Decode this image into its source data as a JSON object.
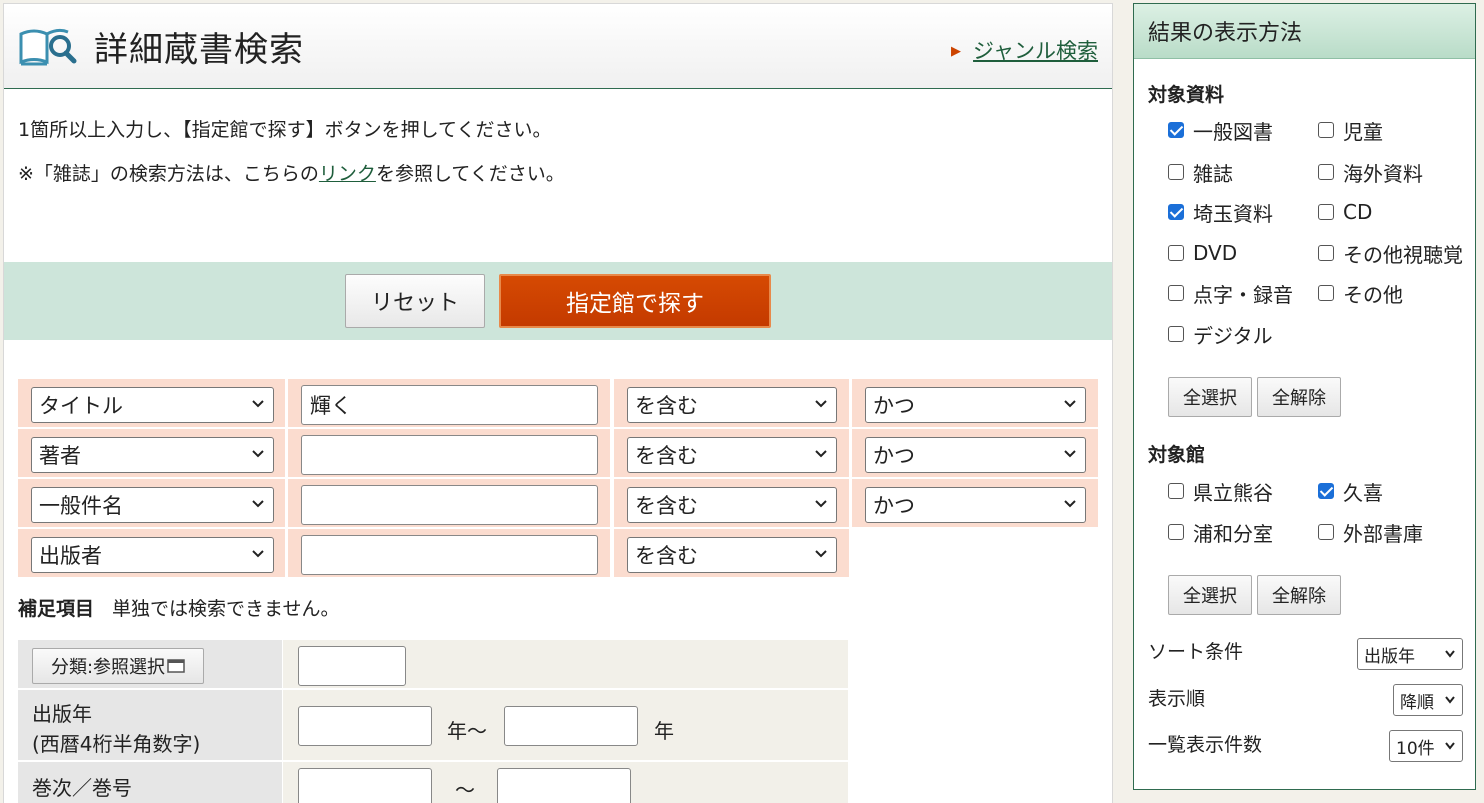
{
  "header": {
    "title": "詳細蔵書検索",
    "genre_link": "ジャンル検索"
  },
  "instructions": {
    "line1": "1箇所以上入力し、【指定館で探す】ボタンを押してください。",
    "line2_pre": "※「雑誌」の検索方法は、こちらの",
    "line2_link": "リンク",
    "line2_post": "を参照してください。"
  },
  "buttons": {
    "reset": "リセット",
    "search": "指定館で探す"
  },
  "search_rows": [
    {
      "field": "タイトル",
      "value": "輝く",
      "match": "を含む",
      "op": "かつ"
    },
    {
      "field": "著者",
      "value": "",
      "match": "を含む",
      "op": "かつ"
    },
    {
      "field": "一般件名",
      "value": "",
      "match": "を含む",
      "op": "かつ"
    },
    {
      "field": "出版者",
      "value": "",
      "match": "を含む"
    }
  ],
  "supplement": {
    "heading": "補足項目",
    "note": "単独では検索できません。",
    "classify_button": "分類:参照選択",
    "pub_year_label1": "出版年",
    "pub_year_label2": "(西暦4桁半角数字)",
    "year_sep": "年～",
    "year_suffix": "年",
    "volume_label": "巻次／巻号",
    "volume_sep": "～"
  },
  "side": {
    "title": "結果の表示方法",
    "materials_heading": "対象資料",
    "materials": [
      {
        "label": "一般図書",
        "checked": true
      },
      {
        "label": "児童",
        "checked": false
      },
      {
        "label": "雑誌",
        "checked": false
      },
      {
        "label": "海外資料",
        "checked": false
      },
      {
        "label": "埼玉資料",
        "checked": true
      },
      {
        "label": "CD",
        "checked": false
      },
      {
        "label": "DVD",
        "checked": false
      },
      {
        "label": "その他視聴覚",
        "checked": false
      },
      {
        "label": "点字・録音",
        "checked": false
      },
      {
        "label": "その他",
        "checked": false
      },
      {
        "label": "デジタル",
        "checked": false
      }
    ],
    "select_all": "全選択",
    "clear_all": "全解除",
    "libraries_heading": "対象館",
    "libraries": [
      {
        "label": "県立熊谷",
        "checked": false
      },
      {
        "label": "久喜",
        "checked": true
      },
      {
        "label": "浦和分室",
        "checked": false
      },
      {
        "label": "外部書庫",
        "checked": false
      }
    ],
    "sort_label": "ソート条件",
    "sort_value": "出版年",
    "order_label": "表示順",
    "order_value": "降順",
    "count_label": "一覧表示件数",
    "count_value": "10件"
  }
}
